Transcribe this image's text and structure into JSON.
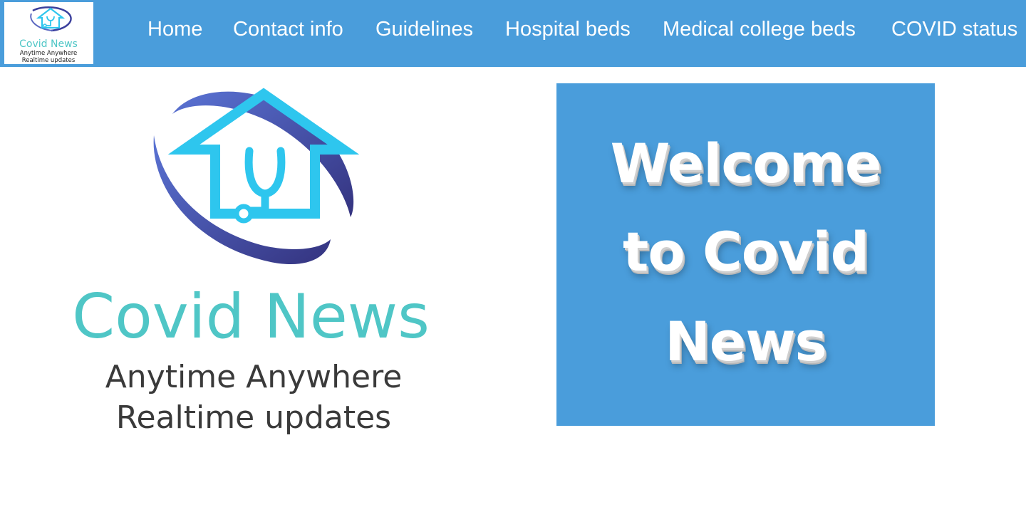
{
  "brand": {
    "logo_title": "Covid News",
    "logo_tagline_1": "Anytime Anywhere",
    "logo_tagline_2": "Realtime updates"
  },
  "nav": {
    "items": [
      {
        "label": "Home"
      },
      {
        "label": "Contact info"
      },
      {
        "label": "Guidelines"
      },
      {
        "label": "Hospital beds"
      },
      {
        "label": "Medical college beds"
      },
      {
        "label": "COVID status"
      }
    ]
  },
  "hero": {
    "title": "Covid News",
    "tagline_1": "Anytime Anywhere",
    "tagline_2": "Realtime updates"
  },
  "welcome": {
    "line_1": "Welcome",
    "line_2": "to Covid",
    "line_3": "News"
  },
  "colors": {
    "navbar_bg": "#4a9ddb",
    "welcome_bg": "#4a9ddb",
    "logo_teal": "#4fc6c6",
    "logo_cyan": "#2ec6ee",
    "logo_navy": "#3b3f9c",
    "tagline_text": "#3a3a3a"
  }
}
